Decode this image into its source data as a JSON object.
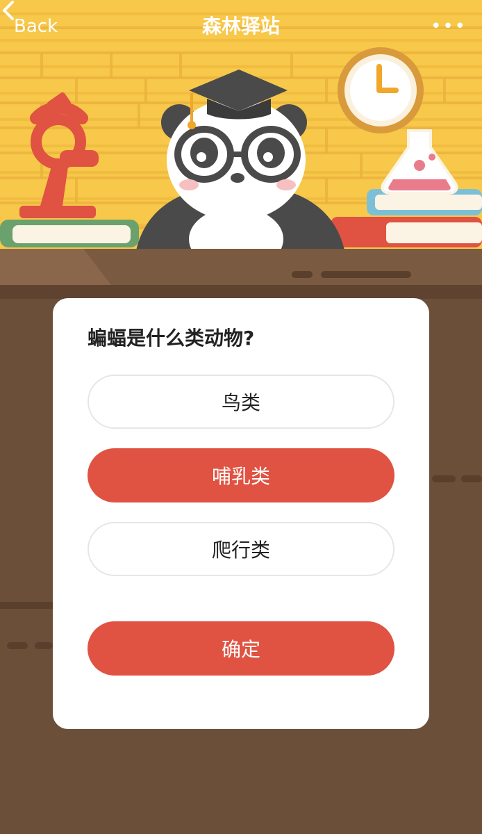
{
  "header": {
    "back_label": "Back",
    "title": "森林驿站",
    "more_label": "•••"
  },
  "quiz": {
    "question": "蝙蝠是什么类动物?",
    "options": [
      {
        "label": "鸟类",
        "selected": false
      },
      {
        "label": "哺乳类",
        "selected": true
      },
      {
        "label": "爬行类",
        "selected": false
      }
    ],
    "confirm_label": "确定"
  },
  "colors": {
    "wall": "#f7c84a",
    "desk": "#6b4f39",
    "accent": "#e05241",
    "card": "#ffffff"
  },
  "icons": {
    "back": "chevron-left-icon",
    "more": "more-dots-icon"
  }
}
